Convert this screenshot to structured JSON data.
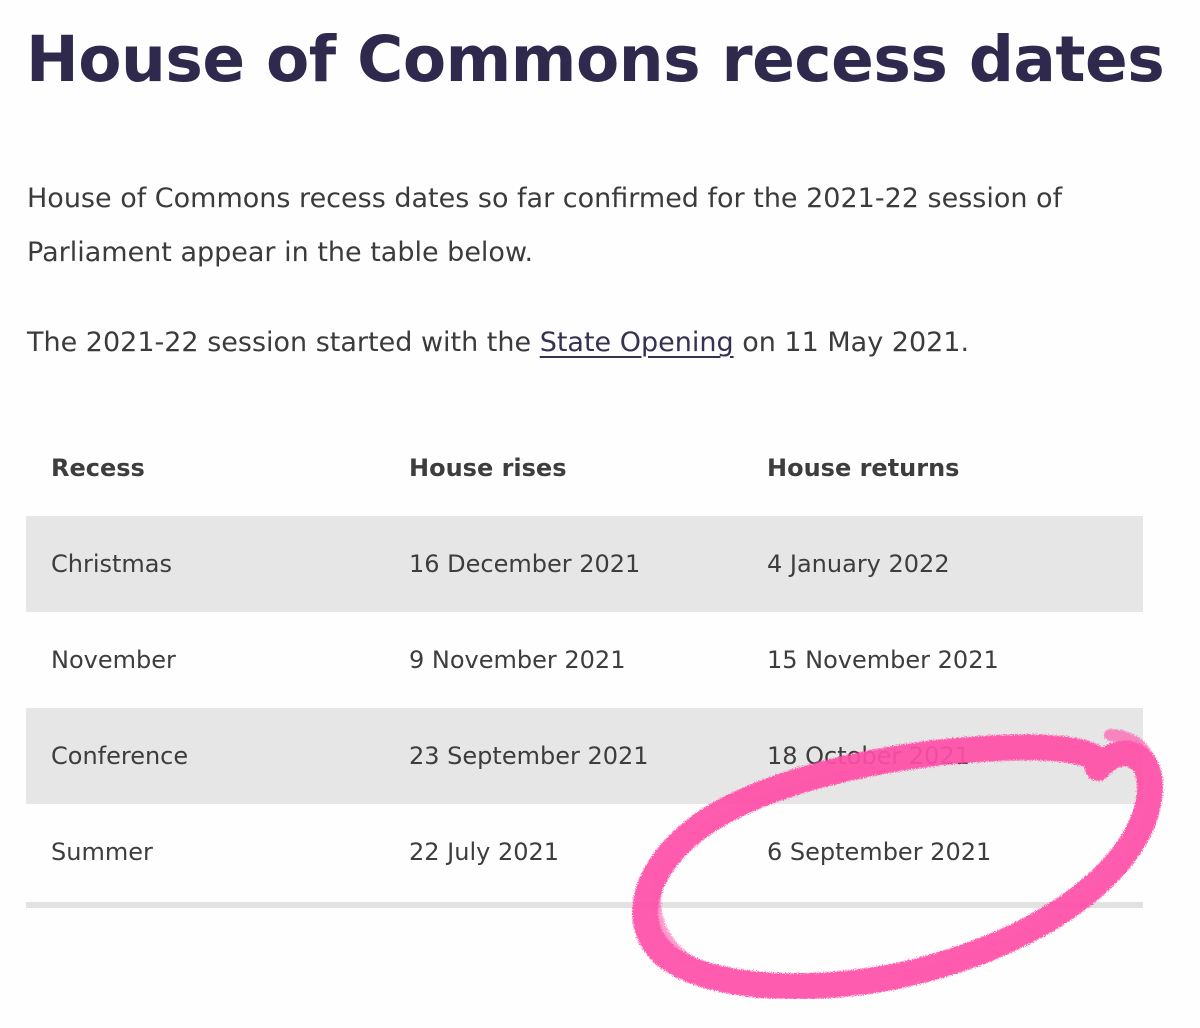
{
  "page": {
    "title": "House of Commons recess dates",
    "intro": "House of Commons recess dates so far confirmed for the 2021-22 session of Parliament appear in the table below.",
    "session_prefix": "The 2021-22 session started with the ",
    "session_link": "State Opening",
    "session_suffix": " on 11 May 2021."
  },
  "table": {
    "headers": [
      "Recess",
      "House rises",
      "House returns"
    ],
    "rows": [
      [
        "Christmas",
        "16 December 2021",
        "4 January 2022"
      ],
      [
        "November",
        "9 November 2021",
        "15 November 2021"
      ],
      [
        "Conference",
        "23 September 2021",
        "18 October 2021"
      ],
      [
        "Summer",
        "22 July 2021",
        "6 September 2021"
      ]
    ]
  },
  "colors": {
    "title": "#2f2a4d",
    "striped_row": "#e7e6e7",
    "highlight_marker": "#ff4fa8"
  },
  "annotation": {
    "type": "hand-drawn circle",
    "target": "Summer row, House returns: 6 September 2021"
  }
}
